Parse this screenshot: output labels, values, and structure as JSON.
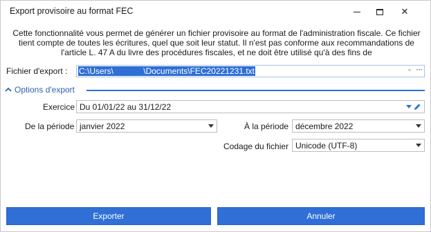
{
  "window": {
    "title": "Export provisoire au format FEC",
    "minimize_label": "—",
    "close_label": "✕"
  },
  "description": "Cette fonctionnalité vous permet de générer un fichier provisoire au format de l'administration fiscale. Ce fichier tient compte de toutes les écritures, quel que soit leur statut. Il n'est pas conforme aux recommandations de l'article L. 47 A du livre des procédures fiscales, et ne doit être utilisé qu'à des fins de",
  "export_file": {
    "label": "Fichier d'export :",
    "value": "C:\\Users\\                  \\Documents\\FEC20221231.txt",
    "browse_label": "···"
  },
  "options": {
    "title": "Options d'export",
    "exercice": {
      "label": "Exercice",
      "value": "Du 01/01/22 au 31/12/22"
    },
    "de_la_periode": {
      "label": "De la période",
      "value": "janvier 2022"
    },
    "a_la_periode": {
      "label": "À la période",
      "value": "décembre 2022"
    },
    "codage": {
      "label": "Codage du fichier",
      "value": "Unicode (UTF-8)"
    }
  },
  "buttons": {
    "export": "Exporter",
    "cancel": "Annuler"
  },
  "colors": {
    "accent": "#2f6fd6",
    "section_title": "#2f5fb3"
  }
}
